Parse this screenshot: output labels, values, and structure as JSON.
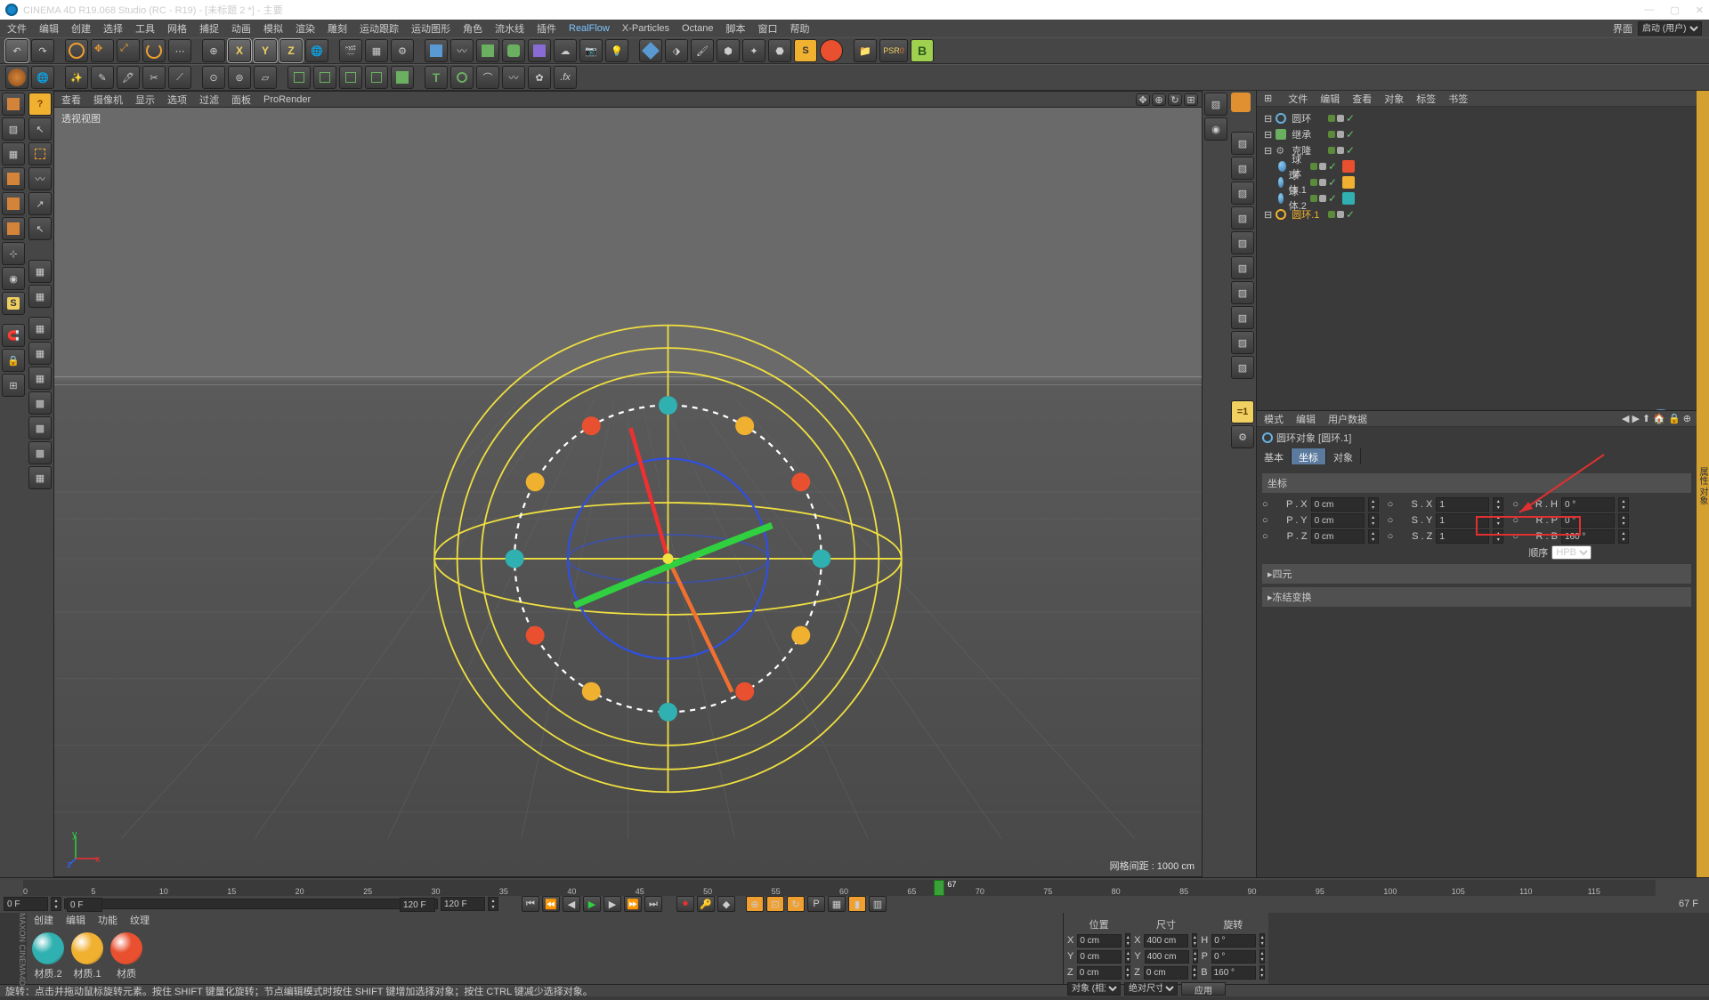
{
  "title": "CINEMA 4D R19.068 Studio (RC - R19) - [未标题 2 *] - 主要",
  "menus": [
    "文件",
    "编辑",
    "创建",
    "选择",
    "工具",
    "网格",
    "捕捉",
    "动画",
    "模拟",
    "渲染",
    "雕刻",
    "运动跟踪",
    "运动图形",
    "角色",
    "流水线",
    "插件",
    "RealFlow",
    "X-Particles",
    "Octane",
    "脚本",
    "窗口",
    "帮助"
  ],
  "menu_hl_idx": 16,
  "layout_label": "界面",
  "layout_value": "启动 (用户)",
  "axes": [
    "X",
    "Y",
    "Z"
  ],
  "viewport": {
    "tabs": [
      "查看",
      "摄像机",
      "显示",
      "选项",
      "过滤",
      "面板",
      "ProRender"
    ],
    "title": "透视视图",
    "grid_info": "网格间距 : 1000 cm"
  },
  "objmgr": {
    "tabs": [
      "文件",
      "编辑",
      "查看",
      "对象",
      "标签",
      "书签"
    ],
    "tree": [
      {
        "indent": 0,
        "icon": "circle",
        "name": "圆环",
        "tag": null
      },
      {
        "indent": 0,
        "icon": "spring",
        "name": "继承",
        "tag": null
      },
      {
        "indent": 0,
        "icon": "gear",
        "name": "克隆",
        "tag": null
      },
      {
        "indent": 1,
        "icon": "sphere",
        "name": "球体",
        "tag": "#e85030"
      },
      {
        "indent": 1,
        "icon": "sphere",
        "name": "球体.1",
        "tag": "#f0b030"
      },
      {
        "indent": 1,
        "icon": "sphere",
        "name": "球体.2",
        "tag": "#30b0b0"
      },
      {
        "indent": 0,
        "icon": "circle-sel",
        "name": "圆环.1",
        "tag": null
      }
    ]
  },
  "attr": {
    "head": [
      "模式",
      "编辑",
      "用户数据"
    ],
    "obj_label": "圆环对象 [圆环.1]",
    "tabs": [
      "基本",
      "坐标",
      "对象"
    ],
    "active_tab": 1,
    "section": "坐标",
    "px_l": "P . X",
    "px_v": "0 cm",
    "py_l": "P . Y",
    "py_v": "0 cm",
    "pz_l": "P . Z",
    "pz_v": "0 cm",
    "sx_l": "S . X",
    "sx_v": "1",
    "sy_l": "S . Y",
    "sy_v": "1",
    "sz_l": "S . Z",
    "sz_v": "1",
    "rh_l": "R . H",
    "rh_v": "0 °",
    "rp_l": "R . P",
    "rp_v": "0 °",
    "rb_l": "R . B",
    "rb_v": "160 °",
    "order_l": "顺序",
    "order_v": "HPB",
    "sec2": "四元",
    "sec3": "冻结变换"
  },
  "timeline": {
    "ticks": [
      0,
      5,
      10,
      15,
      20,
      25,
      30,
      35,
      40,
      45,
      50,
      55,
      60,
      65,
      70,
      75,
      80,
      85,
      90,
      95,
      100,
      105,
      110,
      115
    ],
    "current": 67,
    "current_label": "67",
    "start": "0 F",
    "sstart": "0 F",
    "end": "120 F",
    "send": "120 F",
    "fps": "67 F"
  },
  "materials": {
    "tabs": [
      "创建",
      "编辑",
      "功能",
      "纹理"
    ],
    "items": [
      {
        "name": "材质.2",
        "color": "#30b0b0"
      },
      {
        "name": "材质.1",
        "color": "#f0b030"
      },
      {
        "name": "材质",
        "color": "#e85030"
      }
    ]
  },
  "coord": {
    "heads": [
      "位置",
      "尺寸",
      "旋转"
    ],
    "x_l": "X",
    "y_l": "Y",
    "z_l": "Z",
    "px": "0 cm",
    "py": "0 cm",
    "pz": "0 cm",
    "sx": "400 cm",
    "sy": "400 cm",
    "sz": "0 cm",
    "rh": "H",
    "rp": "P",
    "rb": "B",
    "rhv": "0 °",
    "rpv": "0 °",
    "rbv": "160 °",
    "mode1": "对象 (相对)",
    "mode2": "绝对尺寸",
    "apply": "应用"
  },
  "status": "旋转：点击并拖动鼠标旋转元素。按住 SHIFT 键量化旋转；节点编辑模式时按住 SHIFT 键增加选择对象；按住 CTRL 键减少选择对象。",
  "psr": "PSR",
  "psr0": "0"
}
